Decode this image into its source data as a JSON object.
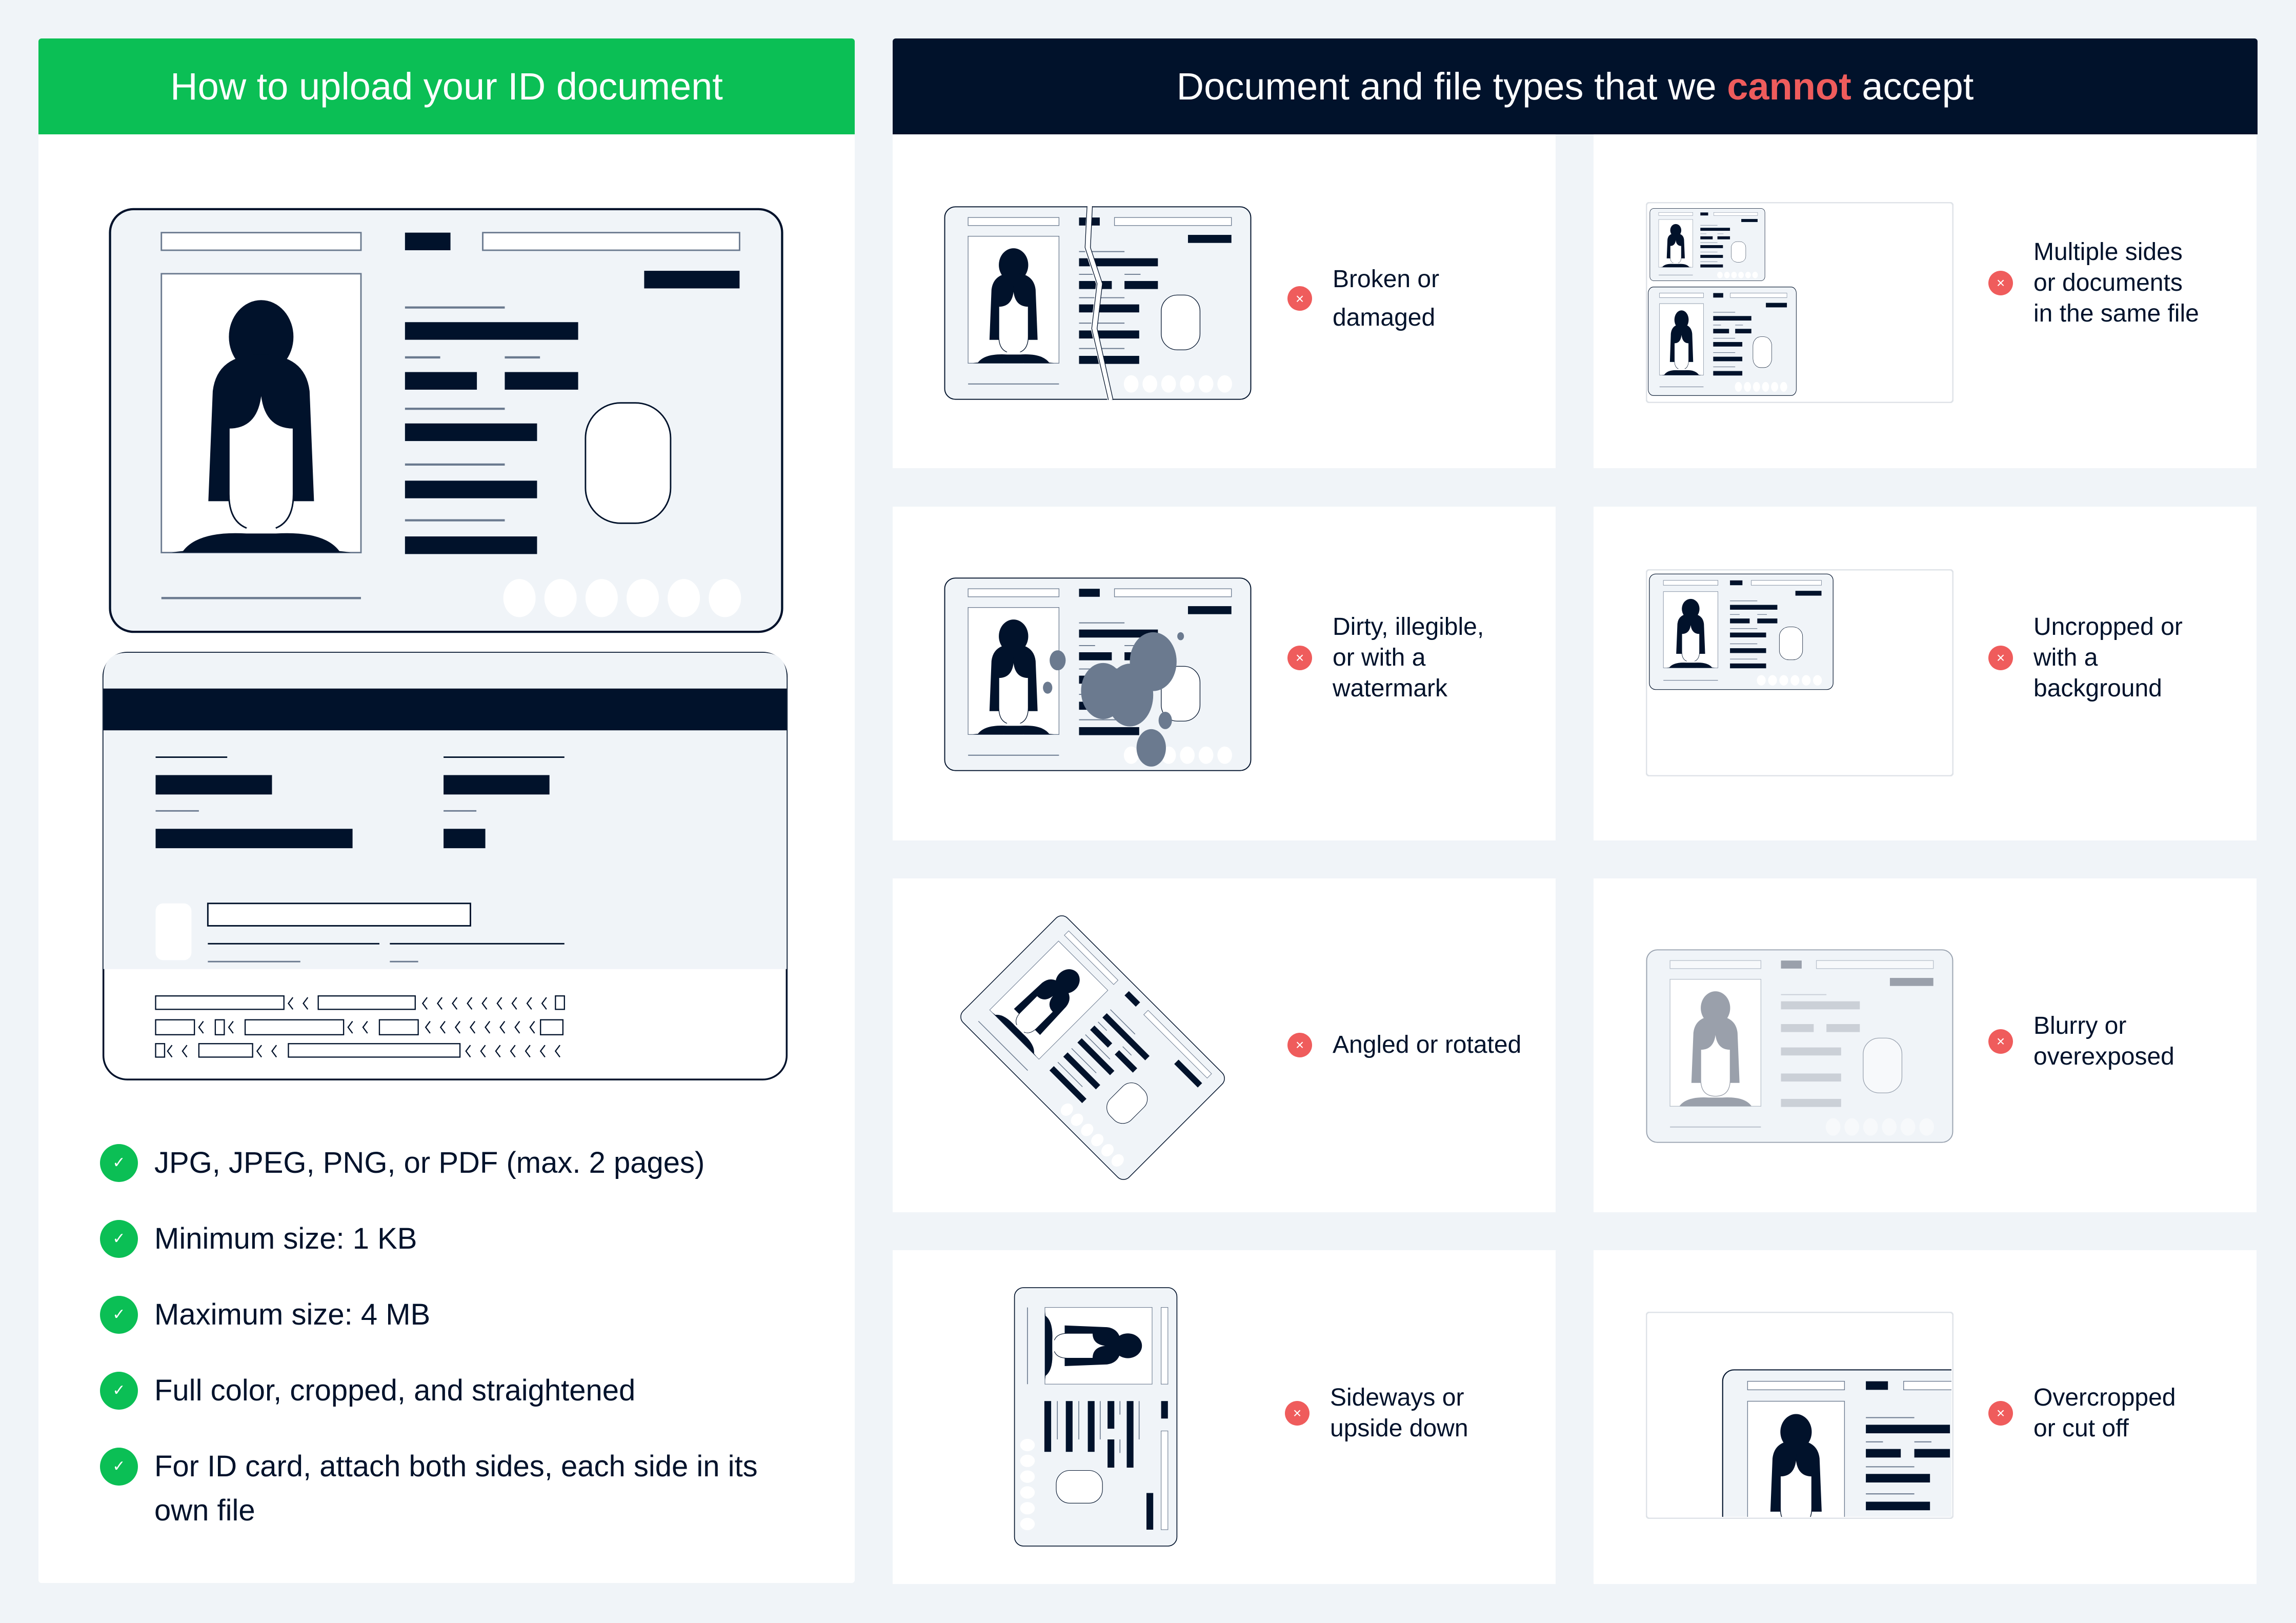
{
  "accepted_panel": {
    "title": "How to upload your ID document",
    "rules": [
      "JPG, JPEG, PNG, or PDF (max. 2 pages)",
      "Minimum size: 1 KB",
      "Maximum size: 4 MB",
      "Full color, cropped, and straightened",
      "For ID card, attach both sides, each side in its own file"
    ],
    "colors": {
      "accent": "#0bbf55",
      "text": "#01122b"
    }
  },
  "rejected_panel": {
    "title_before": "Document and file types that we",
    "title_highlight": "cannot",
    "title_after": "accept",
    "items": [
      {
        "label": "Broken or damaged",
        "icon": "broken-card-illustration"
      },
      {
        "label": "Multiple sides or documents in the same file",
        "icon": "multiple-cards-illustration"
      },
      {
        "label": "Dirty, illegible, or with a watermark",
        "icon": "dirty-card-illustration"
      },
      {
        "label": "Uncropped or with a background",
        "icon": "uncropped-card-illustration"
      },
      {
        "label": "Angled or rotated",
        "icon": "rotated-card-illustration"
      },
      {
        "label": "Blurry or overexposed",
        "icon": "blurry-card-illustration"
      },
      {
        "label": "Sideways or upside down",
        "icon": "sideways-card-illustration"
      },
      {
        "label": "Overcropped or cut off",
        "icon": "overcropped-card-illustration"
      }
    ],
    "badge_symbol": "×",
    "colors": {
      "header": "#01122b",
      "highlight": "#ef5c5c",
      "badge": "#ef5c5c"
    }
  },
  "check_symbol": "✓"
}
